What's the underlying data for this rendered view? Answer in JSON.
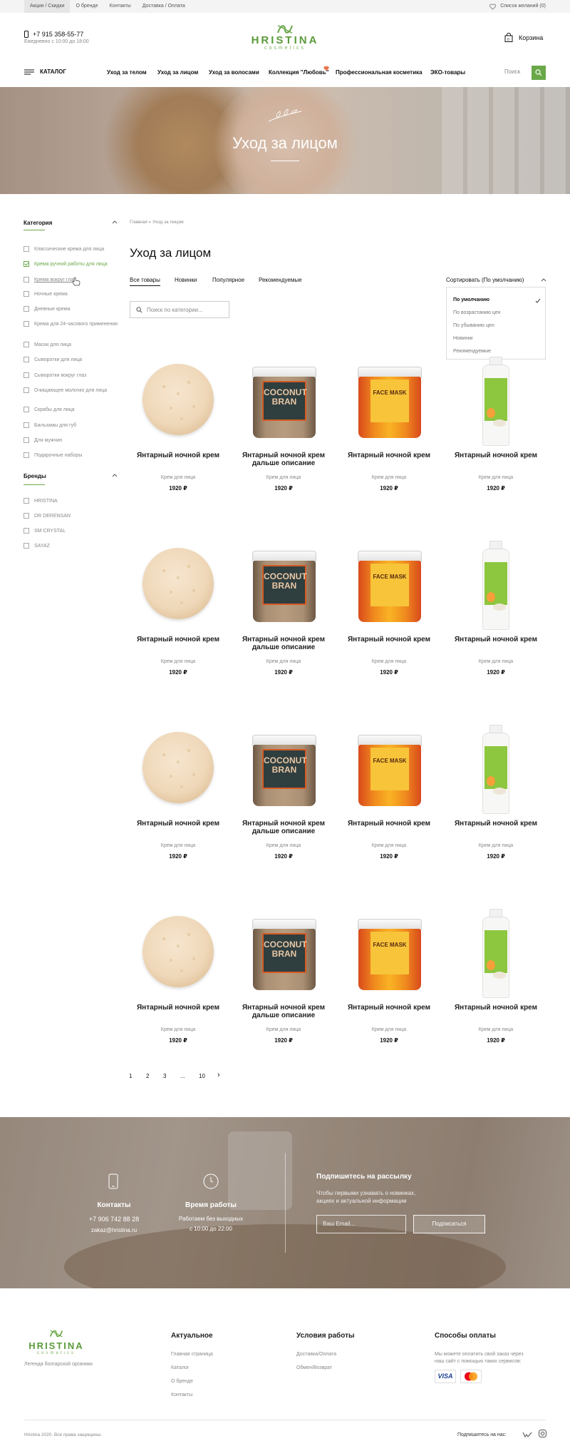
{
  "topbar": {
    "links": [
      "Акции / Скидки",
      "О бренде",
      "Контакты",
      "Доставка / Оплата"
    ],
    "wishlist": "Список желаний (0)"
  },
  "header": {
    "phone": "+7 915 358-55-77",
    "hours": "Ежедневно с 10:00 до 18:00",
    "logo_name": "HRISTINA",
    "logo_sub": "cosmetics",
    "cart_label": "Корзина"
  },
  "nav": {
    "catalog": "КАТАЛОГ",
    "items": [
      "Уход за телом",
      "Уход за лицом",
      "Уход за волосами",
      "Коллекция \"Любовь\"",
      "Профессиональная косметика",
      "ЭКО-товары"
    ],
    "search_placeholder": "Поиск"
  },
  "hero": {
    "title": "Уход за лицом"
  },
  "sidebar": {
    "category_title": "Категория",
    "categories": [
      {
        "label": "Классические крема для лица",
        "checked": false
      },
      {
        "label": "Крема ручной работы для лица",
        "checked": true
      },
      {
        "label": "Крема вокруг глаз",
        "checked": false
      },
      {
        "label": "Ночные крема",
        "checked": false
      },
      {
        "label": "Дневные крема",
        "checked": false
      },
      {
        "label": "Крема для 24-часового применения",
        "checked": false
      },
      {
        "label": "Маски для лица",
        "checked": false
      },
      {
        "label": "Сыворотки для лица",
        "checked": false
      },
      {
        "label": "Сыворотки вокруг глаз",
        "checked": false
      },
      {
        "label": "Очищающее молочко для лица",
        "checked": false
      },
      {
        "label": "Скрабы для лица",
        "checked": false
      },
      {
        "label": "Бальзамы для губ",
        "checked": false
      },
      {
        "label": "Для мужчин",
        "checked": false
      },
      {
        "label": "Подарочные наборы",
        "checked": false
      }
    ],
    "brands_title": "Бренды",
    "brands": [
      "HRISTINA",
      "DR DERENSAN",
      "SM CRYSTAL",
      "SAYAZ"
    ]
  },
  "main": {
    "breadcrumb": "Главная » Уход за лицом",
    "title": "Уход за лицом",
    "tabs": [
      "Все товары",
      "Новинки",
      "Популярное",
      "Рекомендуемые"
    ],
    "sort_label": "Сортировать (По умолчанию)",
    "sort_options": [
      "По умолчанию",
      "По возрастанию цен",
      "По убыванию цен",
      "Новинки",
      "Рекомендуемые"
    ],
    "search_placeholder": "Поиск по категории..."
  },
  "products": [
    {
      "name": "Янтарный ночной крем",
      "category": "Крем для лица",
      "price": "1920 ₽",
      "image": "cream"
    },
    {
      "name": "Янтарный ночной крем дальше описание",
      "category": "Крем для лица",
      "price": "1920 ₽",
      "image": "bran",
      "label": "COCONUT BRAN"
    },
    {
      "name": "Янтарный ночной крем",
      "category": "Крем для лица",
      "price": "1920 ₽",
      "image": "mask",
      "label": "FACE MASK"
    },
    {
      "name": "Янтарный ночной крем",
      "category": "Крем для лица",
      "price": "1920 ₽",
      "image": "bottle"
    }
  ],
  "pagination": [
    "1",
    "2",
    "3",
    "...",
    "10",
    "›"
  ],
  "newsletter": {
    "contacts_title": "Контакты",
    "contacts_phone": "+7 906 742 88 28",
    "contacts_email": "zakaz@hristina.ru",
    "hours_title": "Время работы",
    "hours_line1": "Работаем без выходных",
    "hours_line2": "с 10:00 до 22:00",
    "sub_title": "Подпишитесь на рассылку",
    "sub_text1": "Чтобы первыми узнавать о новинках,",
    "sub_text2": "акциях и актуальной информации",
    "email_placeholder": "Ваш Email...",
    "button": "Подписаться"
  },
  "footer": {
    "tagline": "Легенда болгарской органики",
    "col1_title": "Актуальное",
    "col1_links": [
      "Главная страница",
      "Каталог",
      "О бренде",
      "Контакты"
    ],
    "col2_title": "Условия работы",
    "col2_links": [
      "Доставка/Оплата",
      "Обмен/Возврат"
    ],
    "col3_title": "Способы оплаты",
    "col3_text1": "Мы можете оплатить свой заказ через",
    "col3_text2": "наш сайт с помощью таких сервисов:",
    "visa": "VISA",
    "copyright": "Hristina 2020. Все права защищены.",
    "social_label": "Подпишитесь на нас:"
  },
  "colors": {
    "accent": "#6aa849"
  }
}
